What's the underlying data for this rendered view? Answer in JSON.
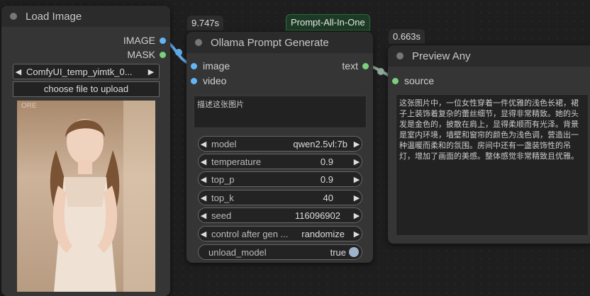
{
  "load_image": {
    "title": "Load Image",
    "outputs": [
      "IMAGE",
      "MASK"
    ],
    "file_value": "ComfyUI_temp_yimtk_0...",
    "upload_label": "choose file to upload",
    "watermark": "ORE"
  },
  "ollama": {
    "time_badge": "9.747s",
    "group_badge": "Prompt-All-In-One",
    "title": "Ollama Prompt Generate",
    "inputs": [
      "image",
      "video"
    ],
    "output": "text",
    "prompt": "描述这张图片",
    "widgets": [
      {
        "name": "model",
        "value": "qwen2.5vl:7b"
      },
      {
        "name": "temperature",
        "value": "0.9"
      },
      {
        "name": "top_p",
        "value": "0.9"
      },
      {
        "name": "top_k",
        "value": "40"
      },
      {
        "name": "seed",
        "value": "116096902"
      },
      {
        "name": "control after gen ...",
        "value": "randomize"
      }
    ],
    "toggle": {
      "name": "unload_model",
      "value": "true"
    }
  },
  "preview": {
    "time_badge": "0.663s",
    "title": "Preview Any",
    "input": "source",
    "text": "这张图片中，一位女性穿着一件优雅的浅色长裙，裙子上装饰着复杂的蕾丝细节，显得非常精致。她的头发是金色的，披散在肩上，显得柔顺而有光泽。背景是室内环境，墙壁和窗帘的颜色为浅色调，营造出一种温暖而柔和的氛围。房间中还有一盏装饰性的吊灯，增加了画面的美感。整体感觉非常精致且优雅。"
  }
}
